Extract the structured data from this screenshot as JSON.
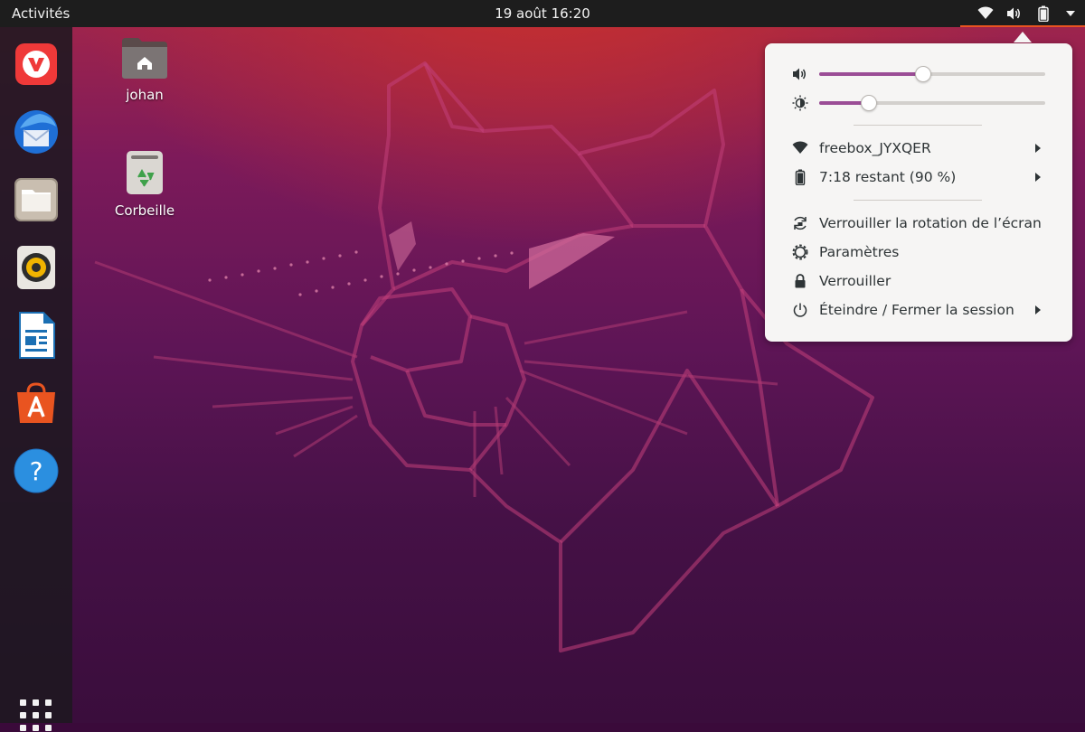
{
  "topbar": {
    "activities_label": "Activités",
    "clock": "19 août  16:20",
    "tray_icons": [
      "wifi-icon",
      "volume-icon",
      "battery-icon",
      "menu-chevron-icon"
    ],
    "accent_color": "#e95420"
  },
  "dock": {
    "items": [
      {
        "name": "vivaldi",
        "icon": "vivaldi-browser-icon"
      },
      {
        "name": "thunderbird",
        "icon": "thunderbird-mail-icon"
      },
      {
        "name": "files",
        "icon": "files-folder-icon"
      },
      {
        "name": "rhythmbox",
        "icon": "rhythmbox-speaker-icon"
      },
      {
        "name": "libreoffice-writer",
        "icon": "writer-document-icon"
      },
      {
        "name": "ubuntu-software",
        "icon": "software-store-icon"
      },
      {
        "name": "help",
        "icon": "help-icon"
      }
    ],
    "show_apps_icon": "app-grid-icon"
  },
  "desktop": {
    "icons": [
      {
        "label": "johan",
        "icon": "home-folder-icon"
      },
      {
        "label": "Corbeille",
        "icon": "trash-icon"
      }
    ]
  },
  "system_menu": {
    "volume_percent": 46,
    "brightness_percent": 22,
    "slider_fill_color": "#9b4d96",
    "items": [
      {
        "label": "freebox_JYXQER",
        "icon": "wifi-icon",
        "has_submenu": true
      },
      {
        "label": "7:18 restant (90 %)",
        "icon": "battery-icon",
        "has_submenu": true
      },
      {
        "label": "Verrouiller la rotation de l’écran",
        "icon": "rotation-lock-icon",
        "has_submenu": false
      },
      {
        "label": "Paramètres",
        "icon": "settings-icon",
        "has_submenu": false
      },
      {
        "label": "Verrouiller",
        "icon": "lock-icon",
        "has_submenu": false
      },
      {
        "label": "Éteindre / Fermer la session",
        "icon": "power-icon",
        "has_submenu": true
      }
    ]
  }
}
